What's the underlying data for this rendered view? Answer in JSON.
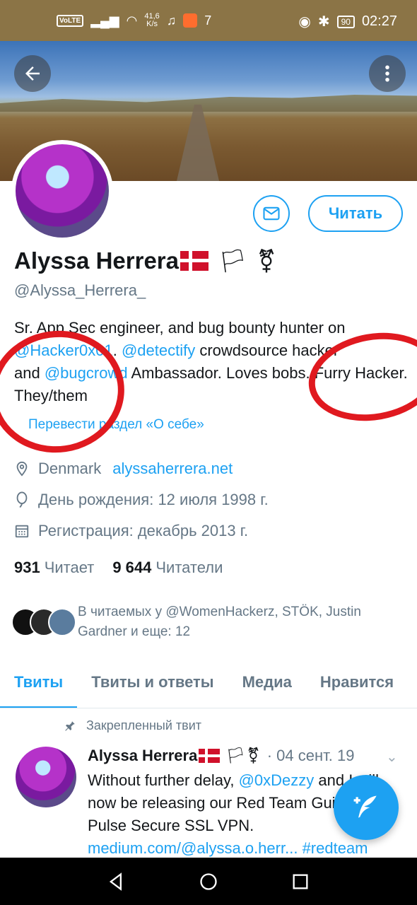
{
  "status_bar": {
    "volte": "VoLTE",
    "speed_value": "41,6",
    "speed_unit": "K/s",
    "notification_count": "7",
    "battery": "90",
    "time": "02:27"
  },
  "profile": {
    "name": "Alyssa Herrera",
    "handle": "@Alyssa_Herrera_",
    "follow_label": "Читать",
    "bio_line1": "Sr. App Sec engineer, and bug bounty hunter on",
    "bio_link1": "@Hacker0x01",
    "bio_sep": ". ",
    "bio_link2": "@detectify",
    "bio_text2": " crowdsource hacker",
    "bio_and": "and ",
    "bio_link3": "@bugcrowd",
    "bio_text3": " Ambassador. Loves bobs. Furry Hacker. They/them",
    "translate_label": "Перевести раздел «О себе»",
    "location": "Denmark",
    "website": "alyssaherrera.net",
    "birthday": "День рождения: 12 июля 1998 г.",
    "joined": "Регистрация: декабрь 2013 г.",
    "following_count": "931",
    "following_label": "Читает",
    "followers_count": "9 644",
    "followers_label": "Читатели",
    "followed_by": "В читаемых у @WomenHackerz, STÖK, Justin Gardner и еще: 12"
  },
  "tabs": [
    {
      "label": "Твиты"
    },
    {
      "label": "Твиты и ответы"
    },
    {
      "label": "Медиа"
    },
    {
      "label": "Нравится"
    }
  ],
  "tweet": {
    "pinned_label": "Закрепленный твит",
    "author": "Alyssa Herrera",
    "date": "· 04 сент. 19",
    "text_a": "Without further delay, ",
    "mention": "@0xDezzy",
    "text_b": " and I will now be releasing our Red Team Guide to Pulse Secure SSL VPN.",
    "url": "medium.com/@alyssa.o.herr...",
    "hashtag": "#redteam"
  },
  "colors": {
    "accent": "#1da1f2",
    "status_bar": "#8b7446",
    "annotation": "#e0191f"
  },
  "icons": [
    "back-arrow-icon",
    "more-vertical-icon",
    "mail-icon",
    "location-pin-icon",
    "balloon-icon",
    "calendar-icon",
    "pin-icon",
    "compose-feather-icon"
  ]
}
